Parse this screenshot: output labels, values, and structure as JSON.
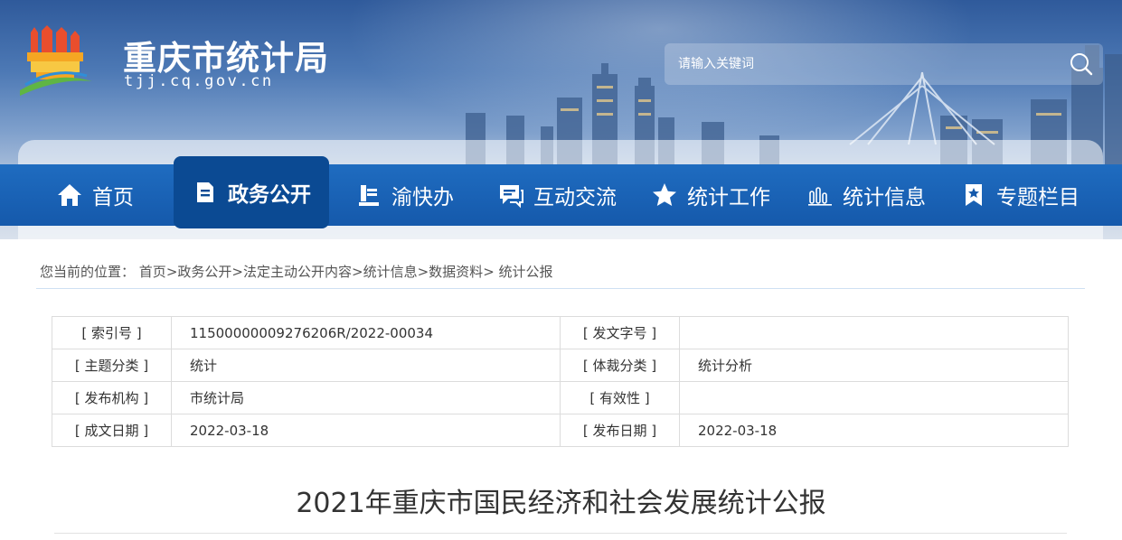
{
  "header": {
    "site_title": "重庆市统计局",
    "site_domain": "tjj.cq.gov.cn",
    "logo_icon": "city-gate-logo-icon",
    "search": {
      "placeholder": "请输入关键词",
      "icon": "search-icon"
    }
  },
  "nav": {
    "items": [
      {
        "label": "首页",
        "icon": "home-icon"
      },
      {
        "label": "政务公开",
        "icon": "document-icon",
        "active": true
      },
      {
        "label": "渝快办",
        "icon": "book-stack-icon"
      },
      {
        "label": "互动交流",
        "icon": "chat-icon"
      },
      {
        "label": "统计工作",
        "icon": "star-icon"
      },
      {
        "label": "统计信息",
        "icon": "bar-chart-icon"
      },
      {
        "label": "专题栏目",
        "icon": "bookmark-star-icon"
      }
    ]
  },
  "breadcrumb": {
    "prefix": "您当前的位置：",
    "items": [
      "首页",
      "政务公开",
      "法定主动公开内容",
      "统计信息",
      "数据资料",
      "统计公报"
    ],
    "separator": ">"
  },
  "meta": {
    "rows": [
      {
        "k1": "[ 索引号 ]",
        "v1": "11500000009276206R/2022-00034",
        "k2": "[ 发文字号 ]",
        "v2": ""
      },
      {
        "k1": "[ 主题分类 ]",
        "v1": "统计",
        "k2": "[ 体裁分类 ]",
        "v2": "统计分析"
      },
      {
        "k1": "[ 发布机构 ]",
        "v1": "市统计局",
        "k2": "[ 有效性 ]",
        "v2": ""
      },
      {
        "k1": "[ 成文日期 ]",
        "v1": "2022-03-18",
        "k2": "[ 发布日期 ]",
        "v2": "2022-03-18"
      }
    ]
  },
  "article": {
    "title": "2021年重庆市国民经济和社会发展统计公报"
  },
  "colors": {
    "nav_bg": "#1559ab",
    "nav_active": "#0b4a93",
    "text": "#333333"
  }
}
